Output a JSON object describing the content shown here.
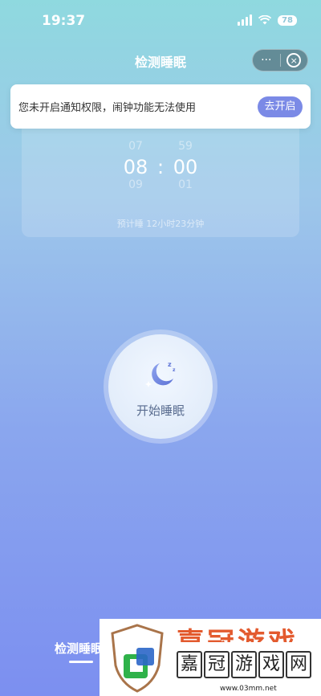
{
  "status_bar": {
    "time": "19:37",
    "battery": "78"
  },
  "header": {
    "title": "检测睡眠",
    "more_glyph": "···",
    "close_glyph": "×"
  },
  "time_picker": {
    "prev": {
      "hour": "07",
      "minute": "59"
    },
    "current": {
      "hour": "08",
      "separator": ":",
      "minute": "00"
    },
    "next": {
      "hour": "09",
      "minute": "01"
    },
    "estimate": "预计睡 12小时23分钟"
  },
  "notice": {
    "text": "您未开启通知权限，闹钟功能无法使用",
    "button": "去开启"
  },
  "sleep_button": {
    "label": "开始睡眠",
    "icon": "moon-icon"
  },
  "bottom_nav": {
    "tab_label": "检测睡眠"
  },
  "watermark": {
    "top_text": "嘉冠游戏",
    "chars": [
      "嘉",
      "冠",
      "游",
      "戏",
      "网"
    ],
    "url": "www.03mm.net"
  },
  "colors": {
    "accent": "#7b8ae6",
    "bg_top": "#8fd9df",
    "bg_bottom": "#7c8ff0",
    "watermark": "#e35a2e"
  }
}
